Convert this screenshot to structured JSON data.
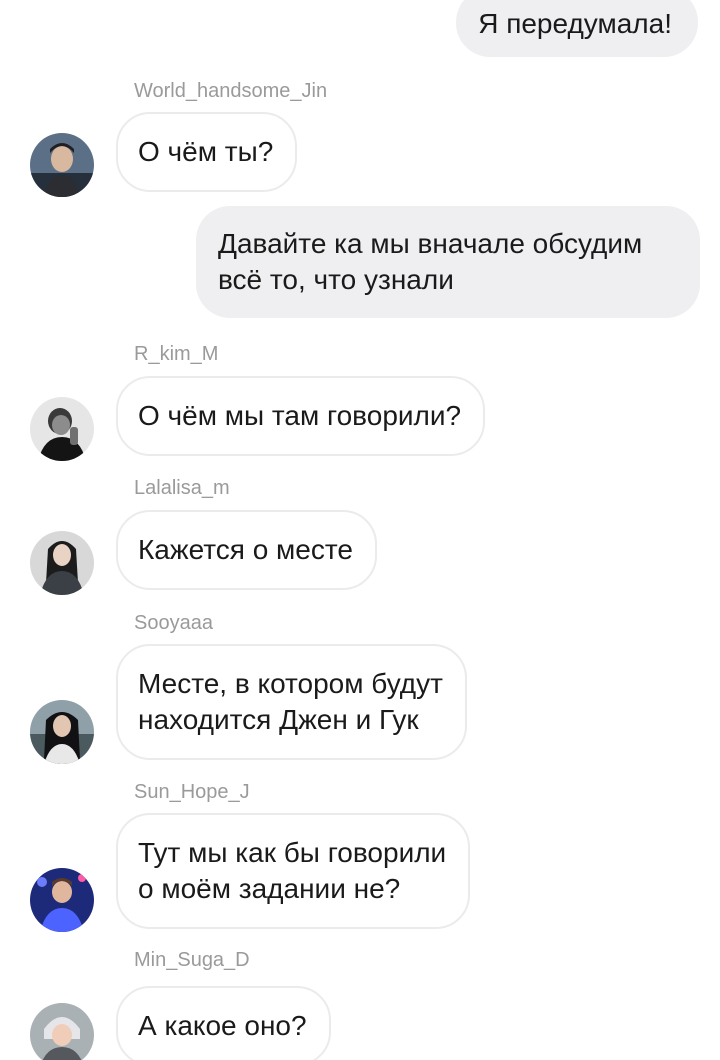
{
  "messages": [
    {
      "type": "outgoing",
      "text": "Я передумала!"
    },
    {
      "type": "incoming",
      "sender": "World_handsome_Jin",
      "text": "О чём ты?",
      "avatar": "avatar-jin"
    },
    {
      "type": "outgoing",
      "text": "Давайте ка мы вначале обсудим\nвсё то, что узнали"
    },
    {
      "type": "incoming",
      "sender": "R_kim_M",
      "text": "О чём мы там говорили?",
      "avatar": "avatar-rm"
    },
    {
      "type": "incoming",
      "sender": "Lalalisa_m",
      "text": "Кажется о месте",
      "avatar": "avatar-lisa"
    },
    {
      "type": "incoming",
      "sender": "Sooyaaa",
      "text": "Месте, в котором будут\nнаходится Джен и Гук",
      "avatar": "avatar-jisoo"
    },
    {
      "type": "incoming",
      "sender": "Sun_Hope_J",
      "text": "Тут мы как бы говорили\nо моём задании не?",
      "avatar": "avatar-jhope"
    },
    {
      "type": "incoming",
      "sender": "Min_Suga_D",
      "text": "А какое оно?",
      "avatar": "avatar-suga"
    }
  ],
  "colors": {
    "outgoing_bubble": "#efeff1",
    "incoming_border": "#ebebeb",
    "sender_name": "#9a9a9a",
    "message_text": "#1a1a1a"
  }
}
